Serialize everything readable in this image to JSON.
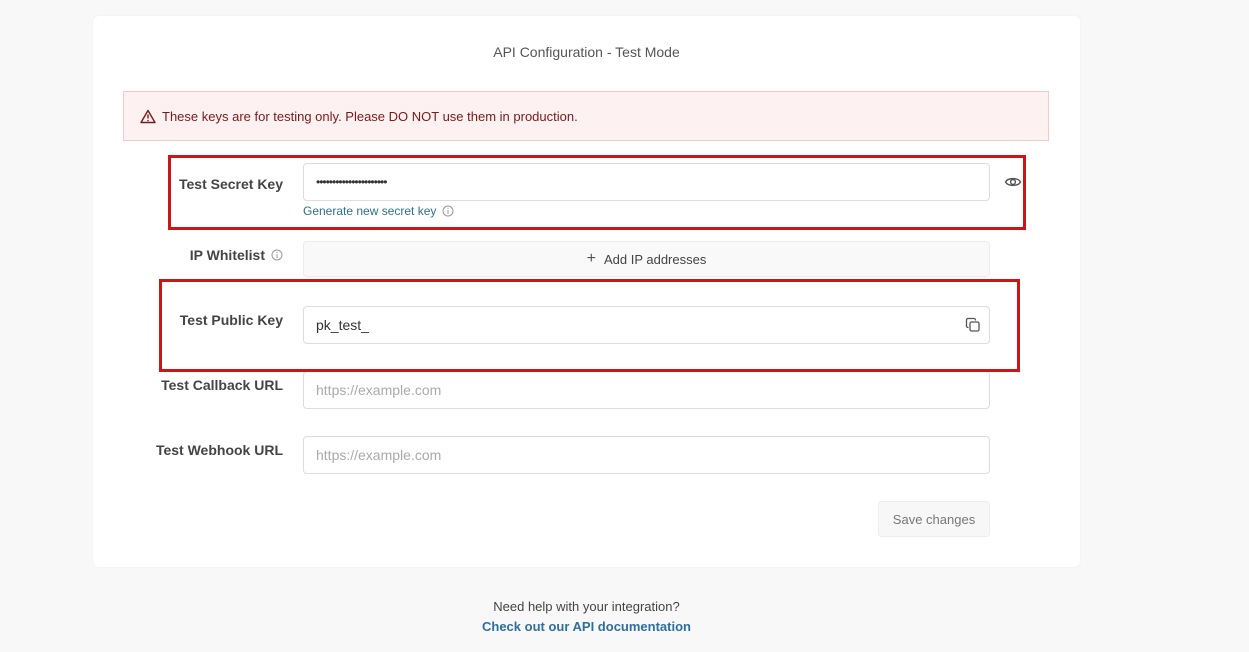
{
  "card": {
    "title": "API Configuration - Test Mode",
    "alert": {
      "icon": "warning-triangle-icon",
      "text": "These keys are for testing only. Please DO NOT use them in production."
    },
    "secret_key": {
      "label": "Test Secret Key",
      "value": "••••••••••••••••••••••",
      "toggle_icon": "eye-icon",
      "generate_link": "Generate new secret key"
    },
    "ip_whitelist": {
      "label": "IP Whitelist",
      "button_label": "Add IP addresses"
    },
    "public_key": {
      "label": "Test Public Key",
      "value": "pk_test_",
      "copy_icon": "copy-icon"
    },
    "callback_url": {
      "label": "Test Callback URL",
      "placeholder": "https://example.com"
    },
    "webhook_url": {
      "label": "Test Webhook URL",
      "placeholder": "https://example.com"
    },
    "save_label": "Save changes"
  },
  "footer": {
    "help_text": "Need help with your integration?",
    "doc_link": "Check out our API documentation"
  },
  "colors": {
    "highlight": "#d0121b",
    "alert_bg": "#fdf1f1",
    "link": "#2f6f9f"
  }
}
